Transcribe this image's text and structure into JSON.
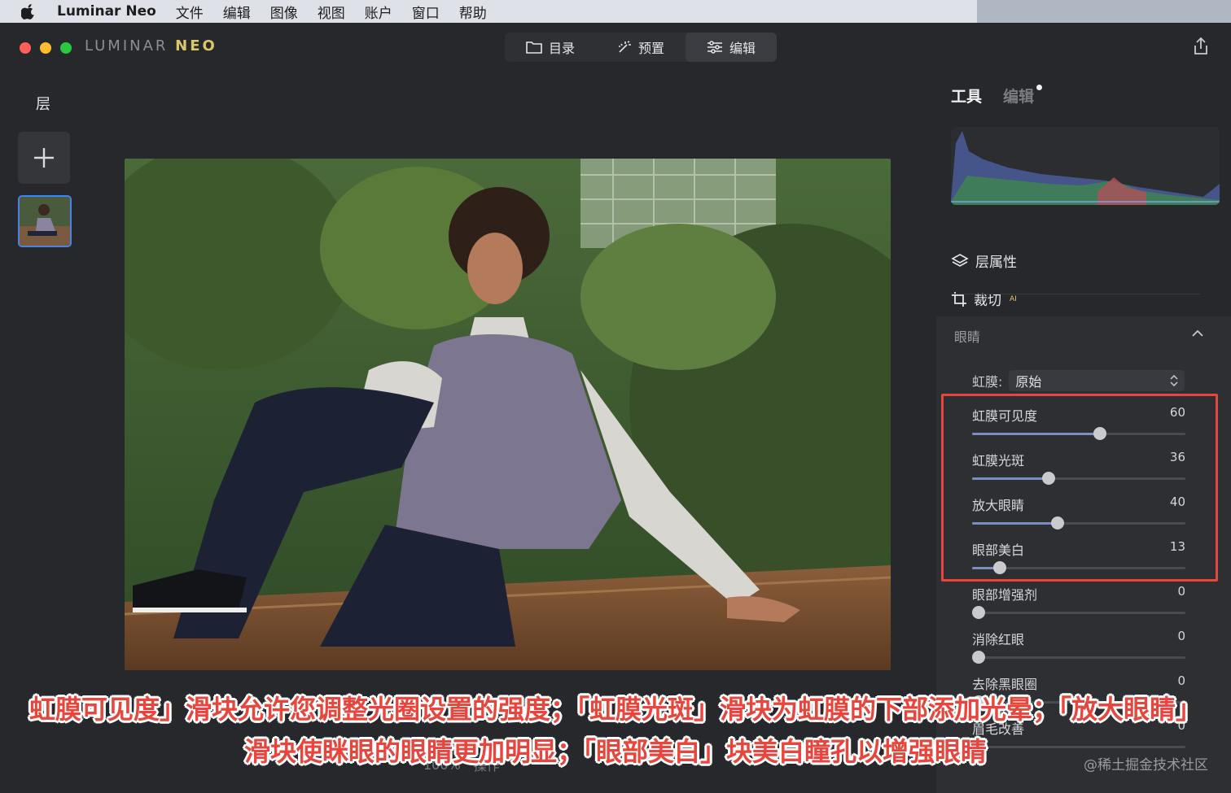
{
  "menubar": {
    "app_name": "Luminar Neo",
    "items": [
      "文件",
      "编辑",
      "图像",
      "视图",
      "账户",
      "窗口",
      "帮助"
    ]
  },
  "window": {
    "logo_part1": "LUMINAR",
    "logo_part2": "NEO",
    "nav_tabs": [
      {
        "label": "目录",
        "icon": "folder-icon"
      },
      {
        "label": "预置",
        "icon": "sparkle-icon"
      },
      {
        "label": "编辑",
        "icon": "sliders-icon"
      }
    ],
    "active_tab": "编辑"
  },
  "left_panel": {
    "title": "层"
  },
  "right_panel": {
    "tab_tools": "工具",
    "tab_edits": "编辑",
    "tool_layer_props": "层属性",
    "tool_crop": "裁切",
    "crop_badge": "AI",
    "section_title": "眼睛",
    "iris_label": "虹膜:",
    "iris_value": "原始",
    "sliders": [
      {
        "label": "虹膜可见度",
        "value": 60,
        "max": 100
      },
      {
        "label": "虹膜光斑",
        "value": 36,
        "max": 100
      },
      {
        "label": "放大眼睛",
        "value": 40,
        "max": 100
      },
      {
        "label": "眼部美白",
        "value": 13,
        "max": 100
      },
      {
        "label": "眼部增强剂",
        "value": 0,
        "max": 100
      },
      {
        "label": "消除红眼",
        "value": 0,
        "max": 100
      },
      {
        "label": "去除黑眼圈",
        "value": 0,
        "max": 100
      },
      {
        "label": "眉毛改善",
        "value": 0,
        "max": 100
      }
    ]
  },
  "bottom": {
    "zoom": "100%",
    "actions": "操作"
  },
  "caption": {
    "line1": "虹膜可见度」滑块允许您调整光圈设置的强度；「虹膜光斑」滑块为虹膜的下部添加光晕；「放大眼睛」",
    "line2": "滑块使眯眼的眼睛更加明显；「眼部美白」块美白瞳孔以增强眼睛"
  },
  "watermark": "@稀土掘金技术社区",
  "colors": {
    "accent_red": "#e8453c",
    "traffic_red": "#ff5f57",
    "traffic_yellow": "#febc2e",
    "traffic_green": "#28c840",
    "slider_fill": "#7a8fbf"
  }
}
